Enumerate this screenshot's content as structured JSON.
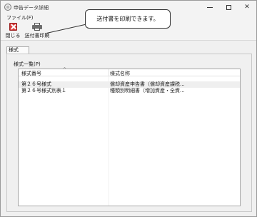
{
  "window": {
    "title": "申告データ詳細"
  },
  "menu": {
    "file": "ファイル(F)"
  },
  "toolbar": {
    "close_label": "閉じる",
    "print_label": "送付書印刷"
  },
  "callout": {
    "text": "送付書を印刷できます。"
  },
  "group": {
    "tab_label": "様式",
    "section_label": "様式一覧(P)"
  },
  "list": {
    "columns": [
      "様式番号",
      "様式名称"
    ],
    "rows": [
      [
        "第２６号様式",
        "償却資産申告書（償却資産課税..."
      ],
      [
        "第２６号様式別表１",
        "種類別明細書（増加資産・全資..."
      ]
    ]
  }
}
